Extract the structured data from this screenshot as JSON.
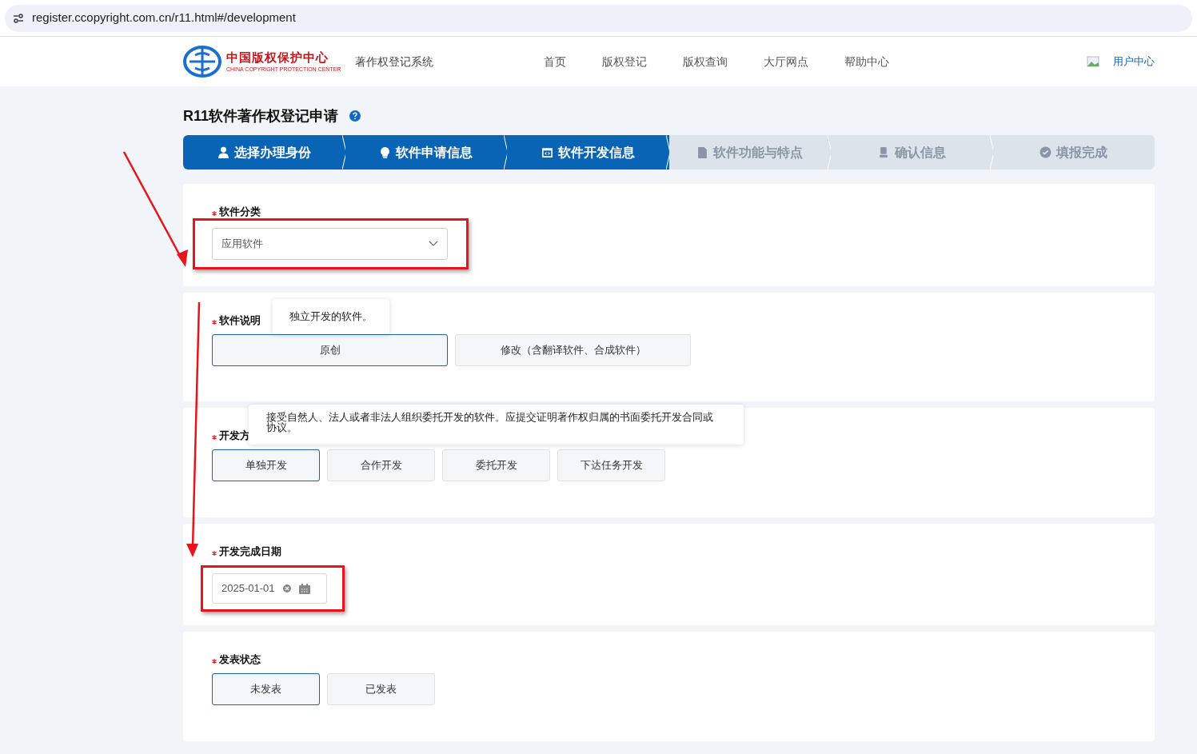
{
  "browser": {
    "url": "register.ccopyright.com.cn/r11.html#/development"
  },
  "header": {
    "logo_cn": "中国版权保护中心",
    "logo_en": "CHINA COPYRIGHT PROTECTION CENTER",
    "system_name": "著作权登记系统",
    "nav": [
      "首页",
      "版权登记",
      "版权查询",
      "大厅网点",
      "帮助中心"
    ],
    "user_center": "用户中心"
  },
  "page_title": "R11软件著作权登记申请",
  "steps": [
    {
      "label": "选择办理身份",
      "selected": true
    },
    {
      "label": "软件申请信息",
      "selected": true
    },
    {
      "label": "软件开发信息",
      "selected": true
    },
    {
      "label": "软件功能与特点",
      "selected": false
    },
    {
      "label": "确认信息",
      "selected": false
    },
    {
      "label": "填报完成",
      "selected": false
    }
  ],
  "sections": [
    {
      "kind": "select",
      "required": true,
      "label": "软件分类",
      "value": "应用软件",
      "highlighted": true
    },
    {
      "kind": "options",
      "required": true,
      "label": "软件说明",
      "tooltip": "独立开发的软件。",
      "options": [
        {
          "label": "原创",
          "selected": true
        },
        {
          "label": "修改（含翻译软件、合成软件）",
          "selected": false
        }
      ]
    },
    {
      "kind": "options",
      "required": true,
      "label": "开发方",
      "tooltip": "接受自然人、法人或者非法人组织委托开发的软件。应提交证明著作权归属的书面委托开发合同或协议。",
      "options": [
        {
          "label": "单独开发",
          "selected": true
        },
        {
          "label": "合作开发",
          "selected": false
        },
        {
          "label": "委托开发",
          "selected": false
        },
        {
          "label": "下达任务开发",
          "selected": false
        }
      ]
    },
    {
      "kind": "date",
      "required": true,
      "label": "开发完成日期",
      "value": "2025-01-01",
      "highlighted": true
    },
    {
      "kind": "options",
      "required": true,
      "label": "发表状态",
      "options": [
        {
          "label": "未发表",
          "selected": true
        },
        {
          "label": "已发表",
          "selected": false
        }
      ]
    }
  ]
}
